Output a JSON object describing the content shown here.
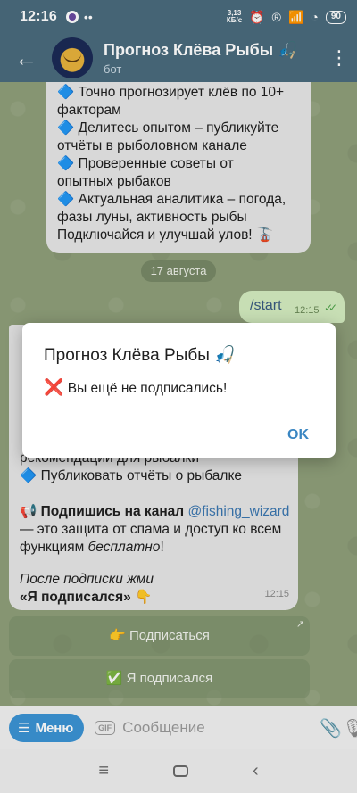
{
  "status": {
    "time": "12:16",
    "dots": "••",
    "speed_top": "3,13",
    "speed_bottom": "КБ/с",
    "battery": "90"
  },
  "header": {
    "title": "Прогноз Клёва Рыбы 🎣",
    "subtitle": "бот"
  },
  "message1": {
    "lines": [
      "🔷 Точно прогнозирует клёв по 10+",
      "факторам",
      "🔷 Делитесь опытом – публикуйте",
      "отчёты в рыболовном канале",
      "🔷 Проверенные советы от",
      "опытных рыбаков",
      "🔷 Актуальная аналитика – погода,",
      "фазы луны, активность рыбы",
      "Подключайся и улучшай улов! 🚡"
    ]
  },
  "date_separator": "17 августа",
  "outgoing": {
    "text": "/start",
    "time": "12:15",
    "checks": "✓✓"
  },
  "message2": {
    "line_partial": "рекомендации для рыбалки",
    "line_publish": "🔷 Публиковать отчёты о рыбалке",
    "subscribe_prefix": "📢 ",
    "subscribe_bold": "Подпишись на канал",
    "subscribe_link": "@fishing_wizard",
    "subscribe_rest": "— это защита от спама и доступ ко всем",
    "subscribe_rest2_a": "функциям ",
    "subscribe_rest2_b": "бесплатно",
    "subscribe_rest2_c": "!",
    "after_sub": "После подписки жми",
    "after_sub_bold": "«Я подписался» 👇",
    "time": "12:15"
  },
  "keyboard": {
    "subscribe": "👉 Подписаться",
    "subscribed": "✅ Я подписался",
    "corner": "↗"
  },
  "input": {
    "menu_label": "Меню",
    "menu_icon": "☰",
    "gif": "GIF",
    "placeholder": "Сообщение"
  },
  "dialog": {
    "title": "Прогноз Клёва Рыбы 🎣",
    "message_icon": "❌",
    "message": "Вы ещё не подписались!",
    "ok": "OK"
  }
}
